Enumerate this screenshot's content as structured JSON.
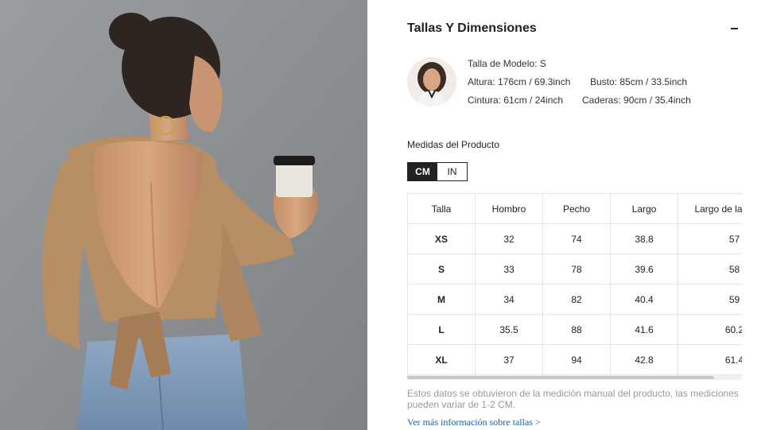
{
  "panel": {
    "title": "Tallas Y Dimensiones",
    "collapse_symbol": "−"
  },
  "model": {
    "size": "Talla de Modelo: S",
    "height": "Altura: 176cm / 69.3inch",
    "bust": "Busto: 85cm / 33.5inch",
    "waist": "Cintura: 61cm / 24inch",
    "hips": "Caderas: 90cm / 35.4inch"
  },
  "product": {
    "section_title": "Medidas del Producto",
    "units": [
      "CM",
      "IN"
    ],
    "active_unit": "CM"
  },
  "size_table": {
    "headers": [
      "Talla",
      "Hombro",
      "Pecho",
      "Largo",
      "Largo de la manga"
    ],
    "rows": [
      [
        "XS",
        "32",
        "74",
        "38.8",
        "57"
      ],
      [
        "S",
        "33",
        "78",
        "39.6",
        "58"
      ],
      [
        "M",
        "34",
        "82",
        "40.4",
        "59"
      ],
      [
        "L",
        "35.5",
        "88",
        "41.6",
        "60.2"
      ],
      [
        "XL",
        "37",
        "94",
        "42.8",
        "61.4"
      ]
    ]
  },
  "note": "Estos datos se obtuvieron de la medición manual del producto, las mediciones pueden variar de 1-2 CM.",
  "more_link": "Ver más información sobre tallas >",
  "icons": {
    "collapse": "minus-icon"
  },
  "colors": {
    "text": "#222222",
    "muted": "#999999",
    "link": "#1a5fa8",
    "border": "#e5e5e5",
    "sweater": "#b88e64",
    "wall": "#8f9295"
  }
}
